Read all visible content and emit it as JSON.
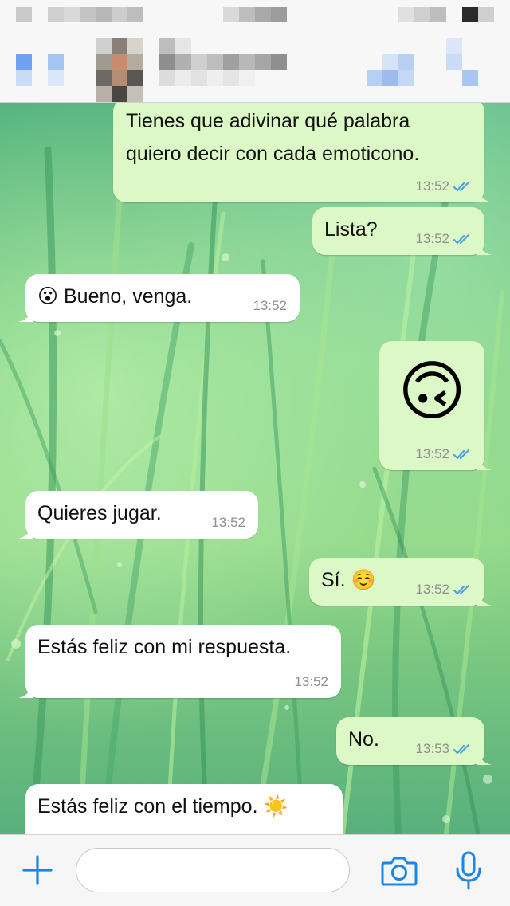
{
  "colors": {
    "outgoing_bubble": "#dcf8c6",
    "incoming_bubble": "#ffffff",
    "read_ticks": "#4fa3e0",
    "accent": "#1a86e6"
  },
  "header": {
    "contact_name": "",
    "status_bar": ""
  },
  "messages": [
    {
      "direction": "outgoing",
      "lines": [
        "Tienes que adivinar qué palabra",
        "quiero decir con cada emoticono."
      ],
      "time": "13:52",
      "status": "read"
    },
    {
      "direction": "outgoing",
      "lines": [
        "Lista?"
      ],
      "time": "13:52",
      "status": "read"
    },
    {
      "direction": "incoming",
      "lines": [
        "😮 Bueno, venga."
      ],
      "time": "13:52"
    },
    {
      "direction": "outgoing",
      "emoji": "🙃",
      "time": "13:52",
      "status": "read"
    },
    {
      "direction": "incoming",
      "lines": [
        "Quieres jugar."
      ],
      "time": "13:52"
    },
    {
      "direction": "outgoing",
      "lines": [
        "Sí. ☺️"
      ],
      "time": "13:52",
      "status": "read"
    },
    {
      "direction": "incoming",
      "lines": [
        "Estás feliz con mi respuesta."
      ],
      "time": "13:52"
    },
    {
      "direction": "outgoing",
      "lines": [
        "No."
      ],
      "time": "13:53",
      "status": "read"
    },
    {
      "direction": "incoming",
      "lines": [
        "Estás feliz con el tiempo. ☀️"
      ],
      "time": ""
    }
  ],
  "input_bar": {
    "add_icon": "plus-icon",
    "message_value": "",
    "camera_icon": "camera-icon",
    "mic_icon": "microphone-icon"
  }
}
